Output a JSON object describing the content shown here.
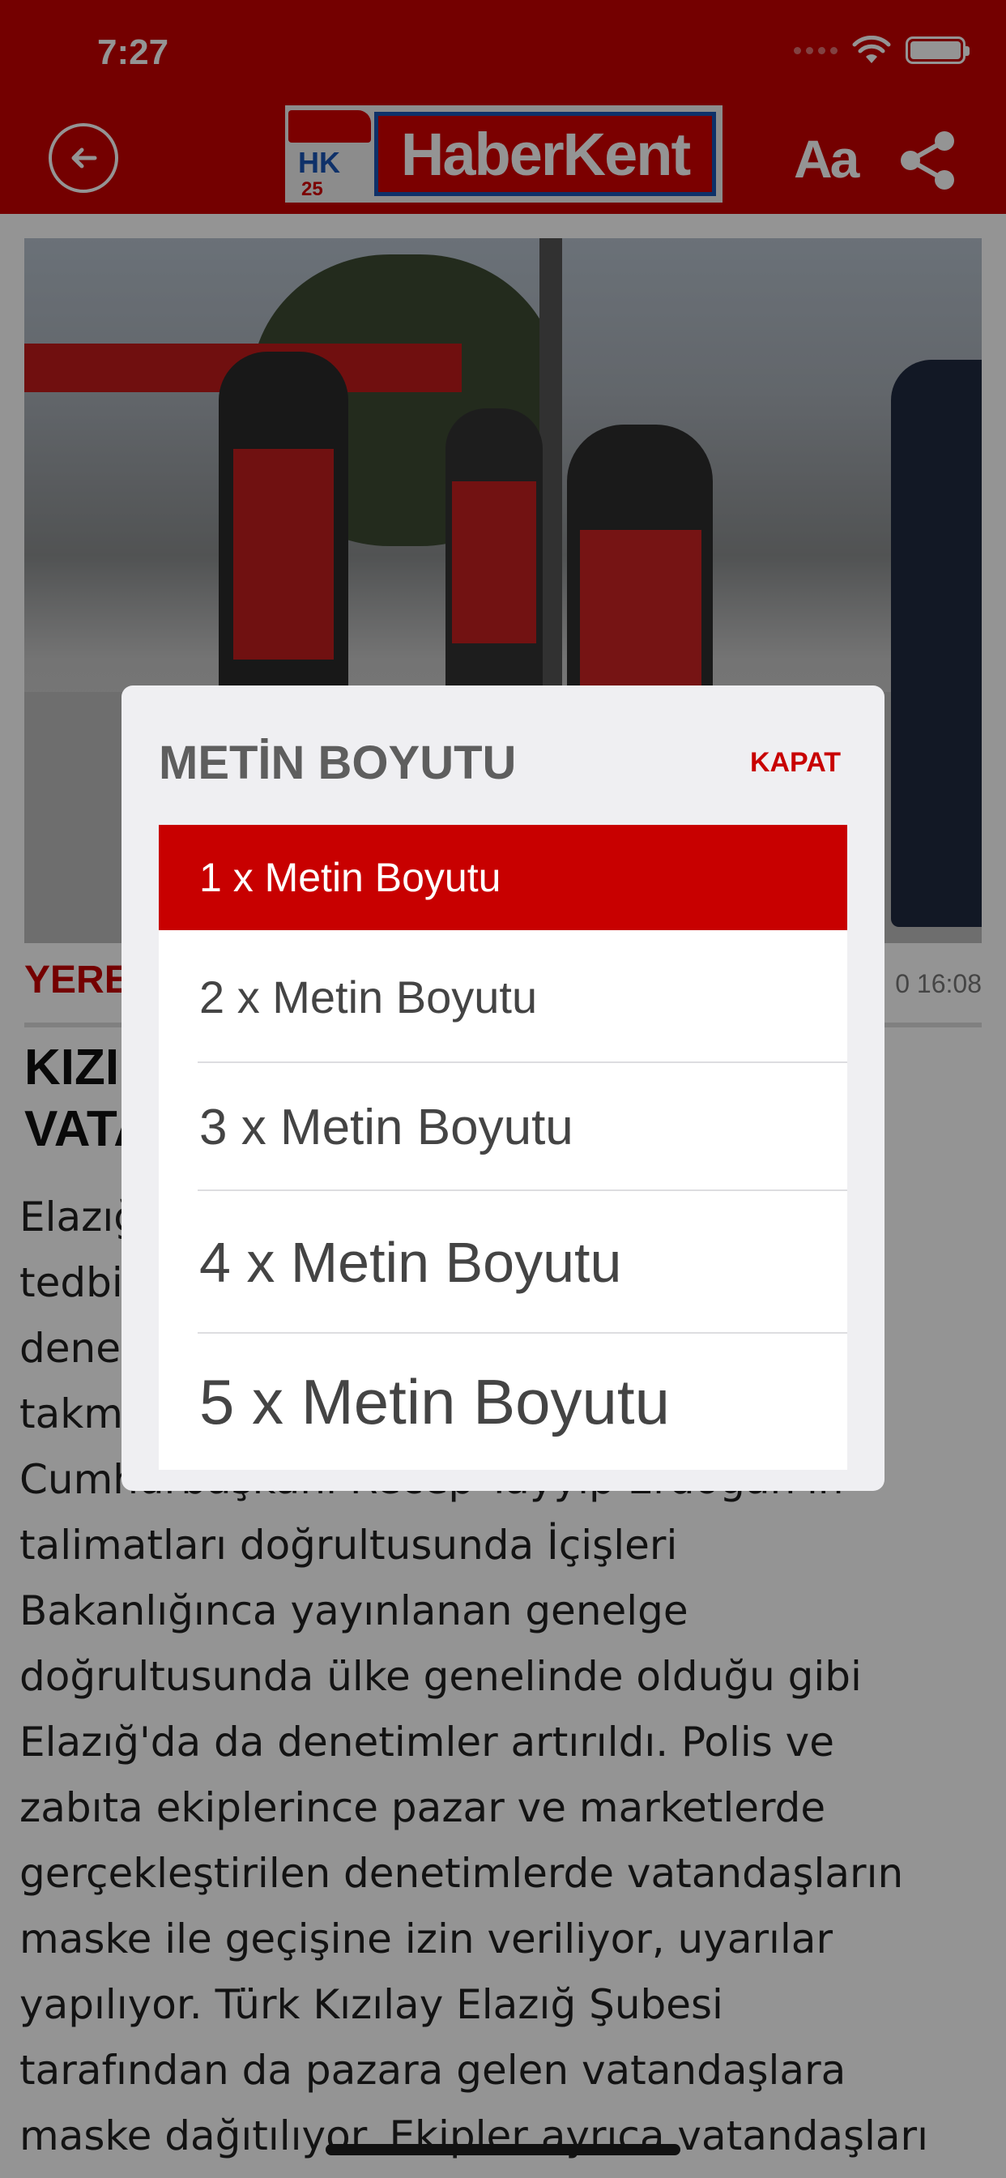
{
  "status_bar": {
    "time": "7:27"
  },
  "header": {
    "logo_text": "HaberKent",
    "logo_badge": "HK",
    "logo_anniversary": "25",
    "font_size_label": "Aa",
    "icons": [
      "back-arrow-icon",
      "share-icon"
    ]
  },
  "article": {
    "category": "YERE",
    "date": "0 16:08",
    "headline": "KIZI\nVATA",
    "body": "Elazığ\ntedbi\ndene\ntakm\nCumhurbaşkanı Recep Tayyip Erdoğan'ın\ntalimatları doğrultusunda İçişleri\nBakanlığınca yayınlanan genelge\ndoğrultusunda ülke genelinde olduğu gibi\nElazığ'da da denetimler artırıldı. Polis ve\nzabıta ekiplerince pazar ve marketlerde\ngerçekleştirilen denetimlerde vatandaşların\nmaske ile geçişine izin veriliyor, uyarılar\nyapılıyor. Türk Kızılay Elazığ Şubesi\ntarafından da pazara gelen vatandaşlara\nmaske dağıtılıyor. Ekipler ayrıca vatandaşları"
  },
  "modal": {
    "title": "METİN BOYUTU",
    "close_label": "KAPAT",
    "options": [
      {
        "label": "1 x Metin Boyutu"
      },
      {
        "label": "2 x Metin Boyutu"
      },
      {
        "label": "3 x Metin Boyutu"
      },
      {
        "label": "4 x Metin Boyutu"
      },
      {
        "label": "5 x Metin Boyutu"
      }
    ],
    "selected_index": 0
  },
  "colors": {
    "brand_red": "#c80000",
    "modal_bg": "#efeff2",
    "overlay": "rgba(0,0,0,0.42)"
  }
}
